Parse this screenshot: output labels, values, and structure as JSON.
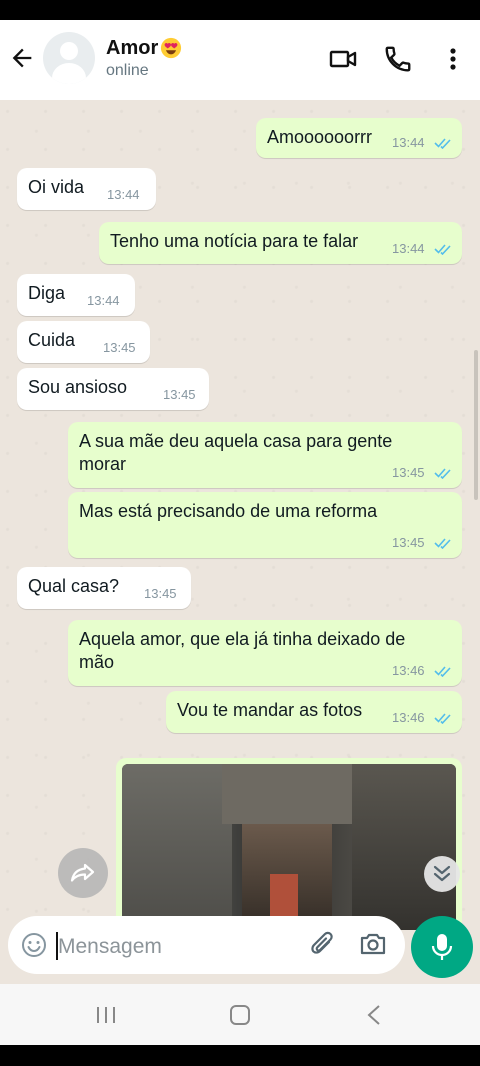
{
  "header": {
    "contact_name": "Amor",
    "status": "online",
    "icons": [
      "back-arrow-icon",
      "avatar",
      "heart-eyes-emoji",
      "video-call-icon",
      "phone-call-icon",
      "more-options-icon"
    ]
  },
  "messages": [
    {
      "dir": "out",
      "text": "Amoooooorrr",
      "time": "13:44",
      "read": true
    },
    {
      "dir": "in",
      "text": "Oi vida",
      "time": "13:44"
    },
    {
      "dir": "out",
      "text": "Tenho uma notícia para te falar",
      "time": "13:44",
      "read": true
    },
    {
      "dir": "in",
      "text": "Diga",
      "time": "13:44"
    },
    {
      "dir": "in",
      "text": "Cuida",
      "time": "13:45"
    },
    {
      "dir": "in",
      "text": "Sou ansioso",
      "time": "13:45"
    },
    {
      "dir": "out",
      "text": "A sua mãe deu aquela casa para gente\nmorar",
      "time": "13:45",
      "read": true
    },
    {
      "dir": "out",
      "text": "Mas está precisando de uma reforma",
      "time": "13:45",
      "read": true
    },
    {
      "dir": "in",
      "text": "Qual casa?",
      "time": "13:45"
    },
    {
      "dir": "out",
      "text": "Aquela amor, que ela já tinha deixado de\nmão",
      "time": "13:46",
      "read": true
    },
    {
      "dir": "out",
      "text": "Vou te mandar as fotos",
      "time": "13:46",
      "read": true
    }
  ],
  "input": {
    "placeholder": "Mensagem"
  },
  "colors": {
    "outgoing_bubble": "#e7fecd",
    "incoming_bubble": "#ffffff",
    "accent": "#00a884",
    "read_ticks": "#53bdeb"
  }
}
